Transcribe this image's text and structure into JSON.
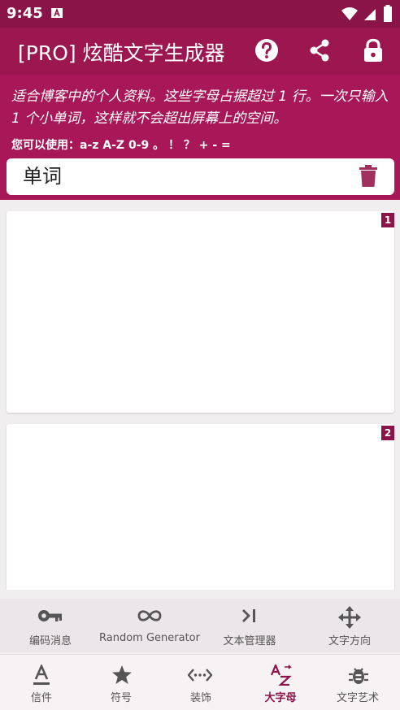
{
  "status_bar": {
    "time": "9:45"
  },
  "app_bar": {
    "title": "[PRO] 炫酷文字生成器"
  },
  "info": {
    "description": "适合博客中的个人资料。这些字母占据超过 1 行。一次只输入 1 个小单词，这样就不会超出屏幕上的空间。",
    "allowed_chars": "您可以使用：a-z A-Z 0-9 。 ！ ？ + - ="
  },
  "input": {
    "placeholder": "单词",
    "value": ""
  },
  "cards": [
    {
      "index": "1"
    },
    {
      "index": "2"
    }
  ],
  "sub_nav": {
    "items": [
      {
        "label": "编码消息",
        "icon": "key-icon"
      },
      {
        "label": "Random Generator",
        "icon": "infinity-icon"
      },
      {
        "label": "文本管理器",
        "icon": "text-cursor-icon"
      },
      {
        "label": "文字方向",
        "icon": "move-arrows-icon"
      }
    ]
  },
  "bottom_nav": {
    "items": [
      {
        "label": "信件",
        "icon": "letter-a-icon"
      },
      {
        "label": "符号",
        "icon": "star-icon"
      },
      {
        "label": "装饰",
        "icon": "code-dots-icon"
      },
      {
        "label": "大字母",
        "icon": "sort-az-icon",
        "active": true
      },
      {
        "label": "文字艺术",
        "icon": "bug-icon"
      }
    ]
  },
  "colors": {
    "primary": "#9c1650",
    "dark": "#8a1447",
    "panel": "#a81758"
  }
}
